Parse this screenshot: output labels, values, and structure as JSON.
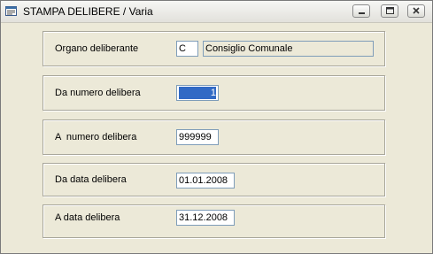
{
  "window": {
    "title": "STAMPA DELIBERE / Varia"
  },
  "form": {
    "organo_label": "Organo deliberante",
    "organo_code": "C",
    "organo_name": "Consiglio Comunale",
    "da_numero_label": "Da numero delibera",
    "da_numero_value": "1",
    "a_numero_label": "A  numero delibera",
    "a_numero_value": "999999",
    "da_data_label": "Da data delibera",
    "da_data_value": "01.01.2008",
    "a_data_label": "A data delibera",
    "a_data_value": "31.12.2008"
  },
  "icons": {
    "window": "window-form-icon",
    "minimize": "minimize-icon",
    "maximize": "maximize-icon",
    "close": "close-icon"
  },
  "colors": {
    "selection": "#316AC5",
    "face": "#ECE9D8",
    "field_border": "#7F9DB9"
  }
}
